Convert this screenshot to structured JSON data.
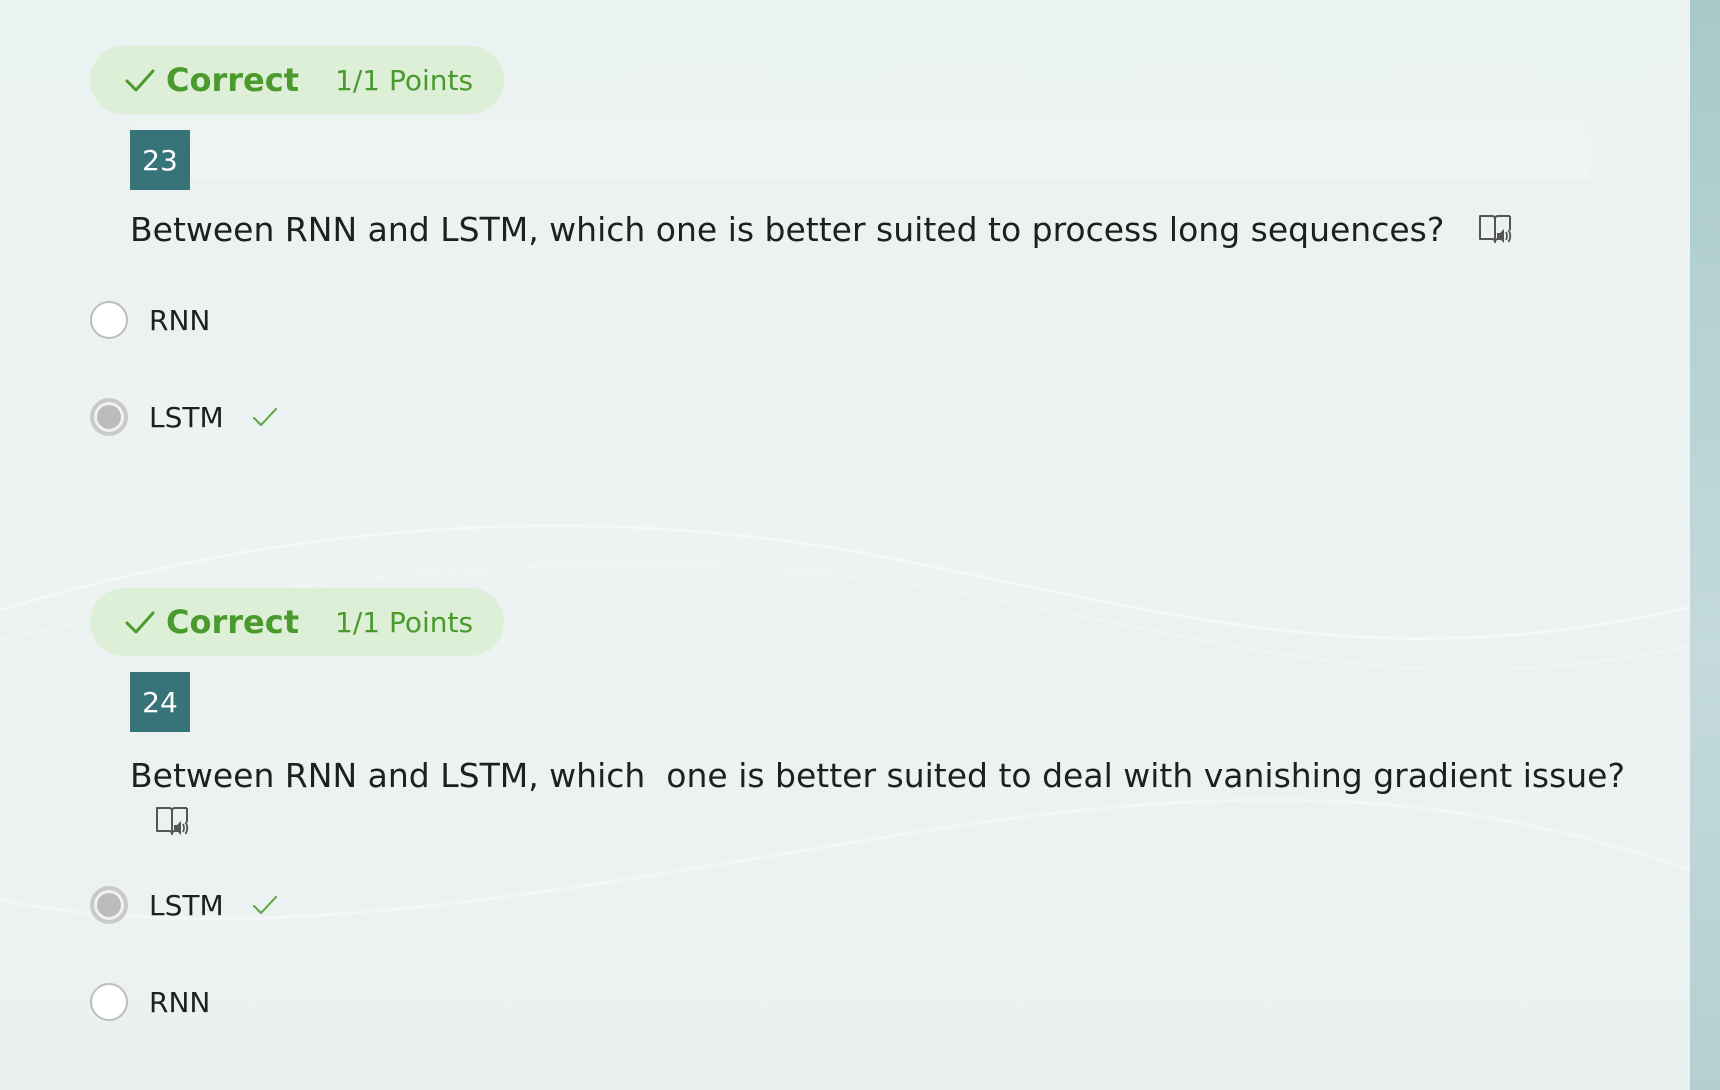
{
  "colors": {
    "correct_green": "#4a9a2e",
    "pill_bg": "#ddefd6",
    "number_badge_bg": "#367479"
  },
  "questions": [
    {
      "result_label": "Correct",
      "points": "1/1 Points",
      "number": "23",
      "text": "Between RNN and LSTM, which one is better suited to process long sequences?",
      "options": [
        {
          "label": "RNN",
          "selected": false,
          "correct": false
        },
        {
          "label": "LSTM",
          "selected": true,
          "correct": true
        }
      ]
    },
    {
      "result_label": "Correct",
      "points": "1/1 Points",
      "number": "24",
      "text": "Between RNN and LSTM, which  one is better suited to deal with vanishing gradient issue?",
      "options": [
        {
          "label": "LSTM",
          "selected": true,
          "correct": true
        },
        {
          "label": "RNN",
          "selected": false,
          "correct": false
        }
      ]
    }
  ],
  "icons": {
    "result": "check-icon",
    "reader": "immersive-reader-icon",
    "answer_correct": "check-icon"
  }
}
